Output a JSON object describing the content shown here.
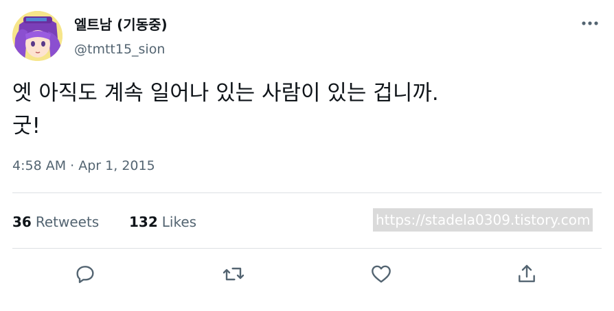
{
  "author": {
    "display_name": "엘트남 (기동중)",
    "handle": "@tmtt15_sion"
  },
  "tweet": {
    "lines": [
      "엣 아직도 계속 일어나 있는 사람이 있는 겁니까.",
      "굿!"
    ],
    "time": "4:58 AM",
    "separator": "·",
    "date": "Apr 1, 2015"
  },
  "stats": {
    "retweets_count": "36",
    "retweets_label": "Retweets",
    "likes_count": "132",
    "likes_label": "Likes"
  },
  "watermark": "https://stadela0309.tistory.com",
  "icons": {
    "more": "more-horizontal-icon",
    "reply": "reply-icon",
    "retweet": "retweet-icon",
    "like": "heart-icon",
    "share": "share-icon"
  },
  "colors": {
    "text_primary": "#0f1419",
    "text_secondary": "#536471",
    "divider": "#dcdfe3",
    "icon": "#536471"
  }
}
